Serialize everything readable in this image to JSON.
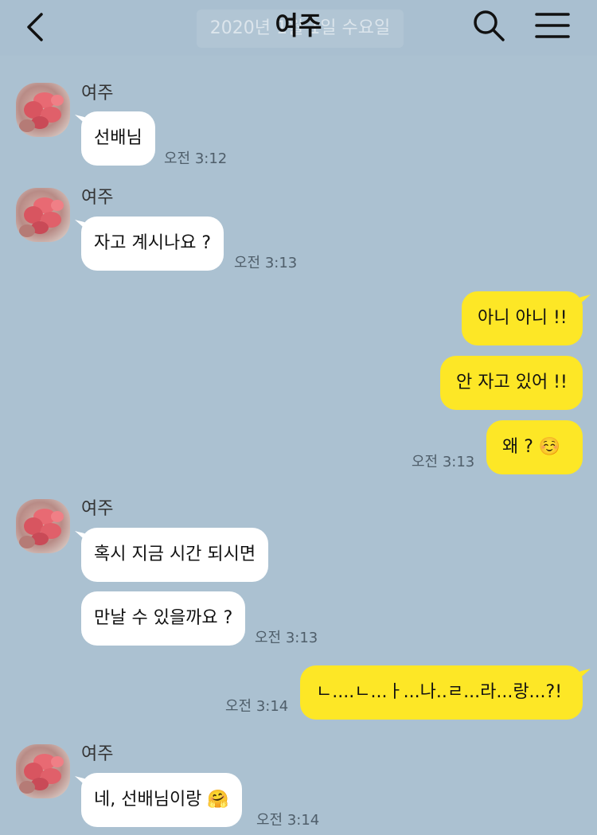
{
  "header": {
    "title": "여주",
    "date_banner": "2020년 1월 1일 수요일"
  },
  "messages": [
    {
      "sender": "여주",
      "text": "선배님",
      "time": "오전 3:12"
    },
    {
      "sender": "여주",
      "text": "자고 계시나요 ?",
      "time": "오전 3:13"
    },
    {
      "text": "아니 아니 !!"
    },
    {
      "text": "안 자고 있어 !!"
    },
    {
      "text": "왜 ? ☺️",
      "time": "오전 3:13"
    },
    {
      "sender": "여주",
      "text": "혹시 지금 시간 되시면"
    },
    {
      "text": "만날 수 있을까요 ?",
      "time": "오전 3:13"
    },
    {
      "text": "ㄴ....ㄴ...ㅏ...나..ㄹ...라...랑...?!",
      "time": "오전 3:14"
    },
    {
      "sender": "여주",
      "text": "네, 선배님이랑 🤗",
      "time": "오전 3:14"
    }
  ],
  "colors": {
    "background": "#abc1d1",
    "outgoing_bubble": "#fde726",
    "incoming_bubble": "#ffffff"
  }
}
